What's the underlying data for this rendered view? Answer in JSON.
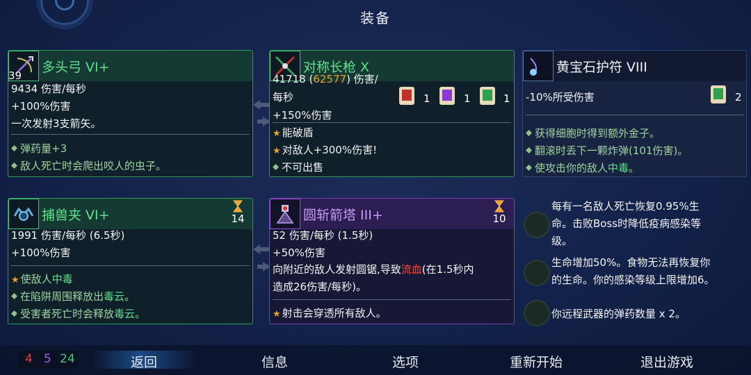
{
  "header": {
    "title": "装备"
  },
  "weapons": [
    {
      "title": "多头弓 VI+",
      "level": "39",
      "dps": "9434 伤害/每秒",
      "bonus": "+100%伤害",
      "desc": "一次发射3支箭矢。",
      "features": [
        "弹药量+3",
        "敌人死亡时会爬出咬人的虫子。"
      ]
    },
    {
      "title": "对称长枪 X",
      "dps_a": "41718 (",
      "dps_crit": "62577",
      "dps_b": ") 伤害/",
      "dps_c": "每秒",
      "scrolls": [
        {
          "icon": "brutality-scroll-icon",
          "count": "1"
        },
        {
          "icon": "tactics-scroll-icon",
          "count": "1"
        },
        {
          "icon": "survival-scroll-icon",
          "count": "1"
        }
      ],
      "bonus": "+150%伤害",
      "features": [
        "能破盾",
        "对敌人+300%伤害!",
        "不可出售"
      ]
    },
    {
      "title": "黄宝石护符 VIII",
      "stat": "-10%所受伤害",
      "scroll_count": "2",
      "features": [
        "获得细胞时得到额外金子。",
        "翻滚时丢下一颗炸弹(101伤害)。",
        "使攻击你的敌人",
        "中毒",
        "。"
      ]
    },
    {
      "title": "捕兽夹 VI+",
      "timer": "14",
      "dps": "1991 伤害/每秒 (6.5秒)",
      "bonus": "+100%伤害",
      "features": [
        "使敌人",
        "中毒",
        "在陷阱周围释放出",
        "毒云",
        "。",
        "受害者死亡时会释放",
        "毒云",
        "。"
      ]
    },
    {
      "title": "圆斩箭塔 III+",
      "timer": "10",
      "dps": "52 伤害/每秒 (1.5秒)",
      "bonus": "+50%伤害",
      "desc_a": "向附近的敌人发射圆锯,导致",
      "desc_bleed": "流血",
      "desc_b": "(在1.5秒内",
      "desc_c": "造成26伤害/每秒)。",
      "features": [
        "射击会穿透所有敌人。"
      ]
    }
  ],
  "mutations": [
    {
      "icon": "recovery-mutation-icon",
      "lines": [
        "每有一名敌人死亡恢复0.95%生",
        "命。击败Boss时降低疫病感染等",
        "级。"
      ]
    },
    {
      "icon": "necromancy-mutation-icon",
      "lines": [
        "生命增加50%。食物无法再恢复你",
        "的生命。你的感染等级上限增加6。"
      ]
    },
    {
      "icon": "ammo-mutation-icon",
      "lines": [
        "你远程武器的弹药数量 x 2。"
      ]
    }
  ],
  "stats": {
    "brutality": "4",
    "tactics": "5",
    "survival": "24"
  },
  "menu": {
    "back": "返回",
    "info": "信息",
    "options": "选项",
    "restart": "重新开始",
    "quit": "退出游戏"
  },
  "colors": {
    "brutality": "#e83a3a",
    "tactics": "#a060e8",
    "survival": "#46c37a"
  }
}
